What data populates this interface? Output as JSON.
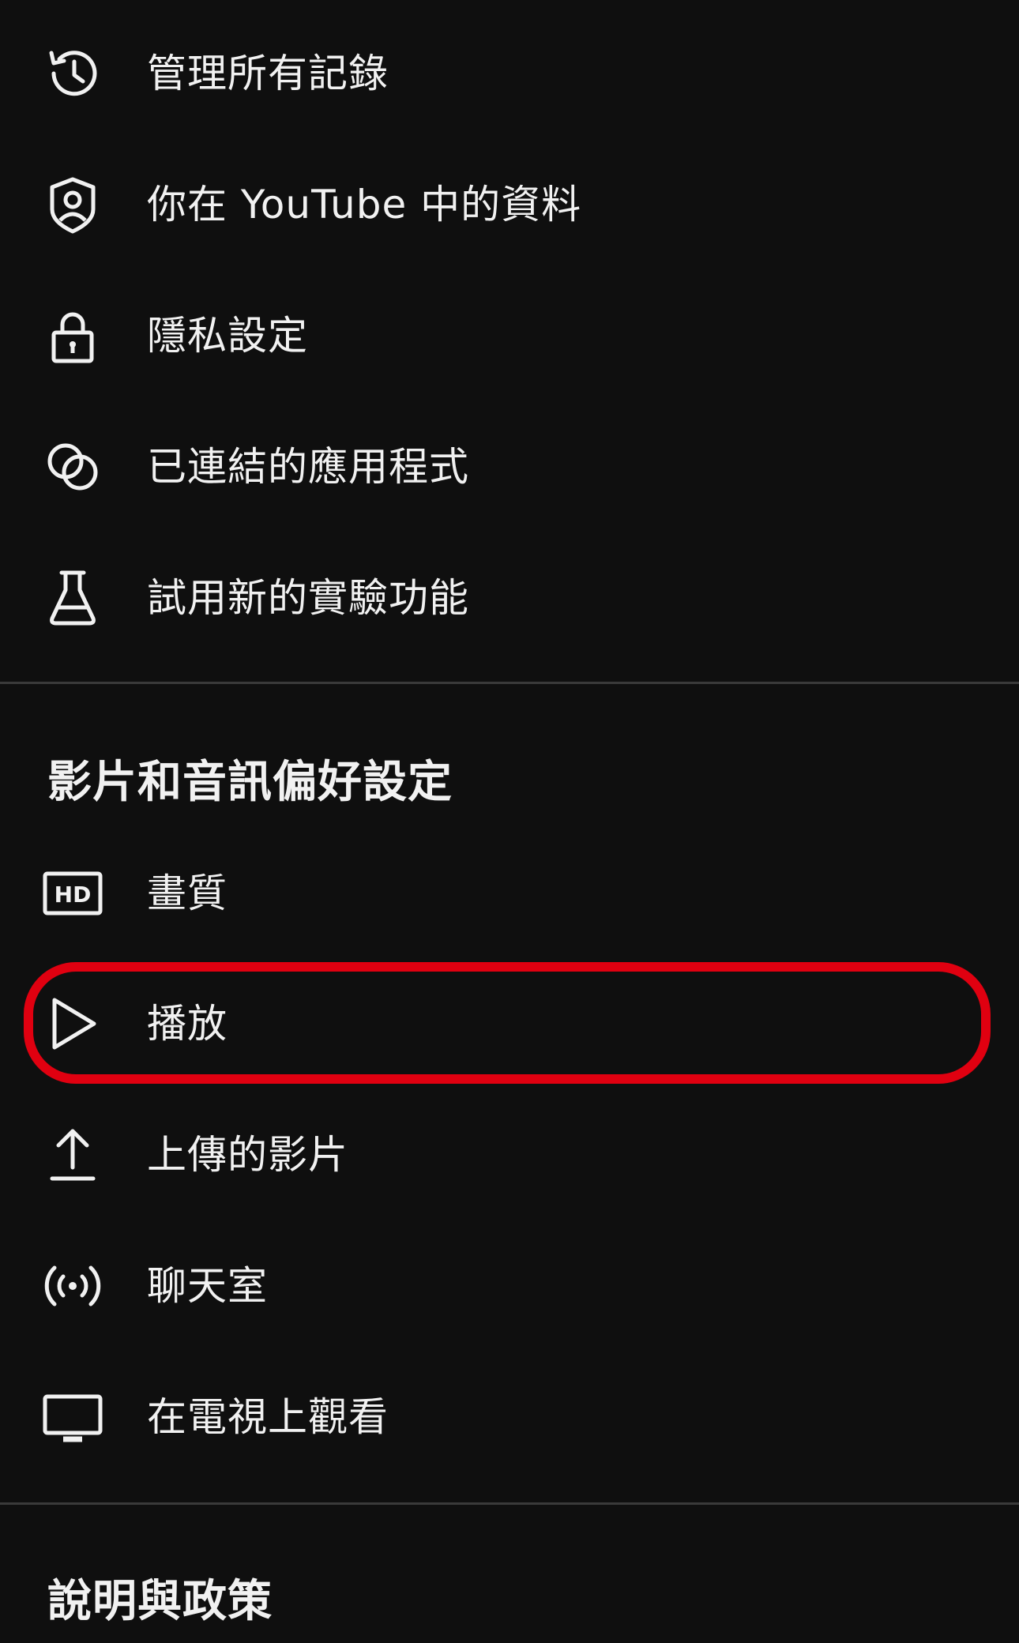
{
  "colors": {
    "background": "#0f0f0f",
    "text": "#f1f1f1",
    "divider": "#3a3a3a",
    "highlight": "#e00010"
  },
  "account_items": [
    {
      "label": "管理所有記錄",
      "icon": "history-icon"
    },
    {
      "label": "你在 YouTube 中的資料",
      "icon": "shield-person-icon"
    },
    {
      "label": "隱私設定",
      "icon": "lock-icon"
    },
    {
      "label": "已連結的應用程式",
      "icon": "linked-circles-icon"
    },
    {
      "label": "試用新的實驗功能",
      "icon": "flask-icon"
    }
  ],
  "video_audio_section": {
    "title": "影片和音訊偏好設定",
    "items": [
      {
        "label": "畫質",
        "icon": "hd-icon"
      },
      {
        "label": "播放",
        "icon": "play-icon"
      },
      {
        "label": "上傳的影片",
        "icon": "upload-icon"
      },
      {
        "label": "聊天室",
        "icon": "live-broadcast-icon"
      },
      {
        "label": "在電視上觀看",
        "icon": "tv-icon"
      }
    ]
  },
  "help_section": {
    "title": "說明與政策"
  }
}
